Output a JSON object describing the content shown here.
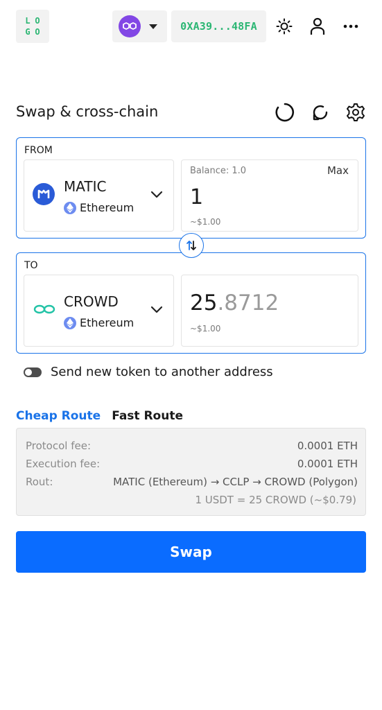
{
  "header": {
    "logo_tl": "L",
    "logo_tr": "O",
    "logo_bl": "G",
    "logo_br": "O",
    "network_icon": "polygon-icon",
    "wallet_address": "0XA39...48FA",
    "theme_icon": "sun-icon",
    "account_icon": "user-icon",
    "more_icon": "more-icon"
  },
  "title": {
    "text": "Swap & cross-chain",
    "icons": [
      "loading-icon",
      "refresh-icon",
      "gear-icon"
    ]
  },
  "from": {
    "label": "FROM",
    "token": "MATIC",
    "chain": "Ethereum",
    "balance": "Balance: 1.0",
    "max_label": "Max",
    "amount": "1",
    "usd": "~$1.00"
  },
  "to": {
    "label": "TO",
    "token": "CROWD",
    "chain": "Ethereum",
    "amount_int": "25",
    "amount_dec": ".8712",
    "usd": "~$1.00"
  },
  "toggle": {
    "label": "Send new token to another address",
    "on": false
  },
  "routes": {
    "tabs": [
      "Cheap Route",
      "Fast Route"
    ],
    "active": 0,
    "protocol_fee_label": "Protocol fee:",
    "protocol_fee": "0.0001 ETH",
    "execution_fee_label": "Execution fee:",
    "execution_fee": "0.0001 ETH",
    "rout_label": "Rout:",
    "rout": "MATIC (Ethereum) → CCLP → CROWD (Polygon)",
    "rate": "1 USDT = 25 CROWD (~$0.79)"
  },
  "swap_label": "Swap",
  "colors": {
    "accent": "#1a73e8",
    "swap_button": "#0a6cff",
    "address": "#2bb673",
    "polygon": "#8247e5",
    "matic_icon": "#2a5bd7",
    "crowd_icon": "#22c3a6"
  }
}
